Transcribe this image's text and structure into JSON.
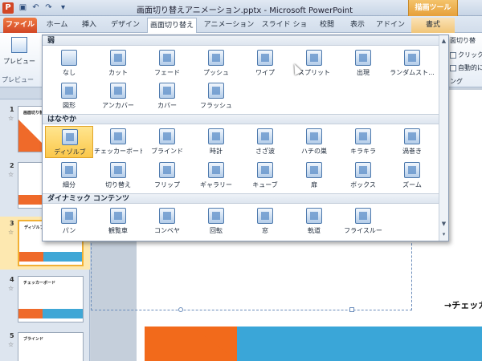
{
  "titlebar": {
    "app_icon": "P",
    "title": "画面切り替えアニメーション.pptx - Microsoft PowerPoint",
    "context_tab": "描画ツール",
    "qat_icons": [
      "save-icon",
      "undo-icon",
      "redo-icon",
      "customize-icon"
    ]
  },
  "tabs": [
    {
      "label": "ファイル",
      "kind": "file"
    },
    {
      "label": "ホーム"
    },
    {
      "label": "挿入"
    },
    {
      "label": "デザイン"
    },
    {
      "label": "画面切り替え",
      "kind": "active"
    },
    {
      "label": "アニメーション"
    },
    {
      "label": "スライド ショー"
    },
    {
      "label": "校閲"
    },
    {
      "label": "表示"
    },
    {
      "label": "アドイン"
    },
    {
      "label": "書式",
      "kind": "context"
    }
  ],
  "ribbon": {
    "preview_label": "プレビュー",
    "group_label": "プレビュー",
    "options": [
      "面切り替",
      "クリック時",
      "自動的に"
    ],
    "side_label": "ング"
  },
  "gallery": {
    "categories": [
      {
        "label": "弱",
        "items": [
          "なし",
          "カット",
          "フェード",
          "プッシュ",
          "ワイプ",
          "スプリット",
          "出現",
          "ランダムスト...",
          "図形",
          "アンカバー",
          "カバー",
          "フラッシュ"
        ]
      },
      {
        "label": "はなやか",
        "items": [
          "ディゾルブ",
          "チェッカーボード",
          "ブラインド",
          "時計",
          "さざ波",
          "ハチの巣",
          "キラキラ",
          "渦巻き",
          "細分",
          "切り替え",
          "フリップ",
          "ギャラリー",
          "キューブ",
          "扉",
          "ボックス",
          "ズーム"
        ]
      },
      {
        "label": "ダイナミック コンテンツ",
        "items": [
          "パン",
          "観覧車",
          "コンベヤ",
          "回転",
          "窓",
          "軌道",
          "フライスルー"
        ]
      }
    ],
    "selected": "ディゾルブ"
  },
  "slides": [
    {
      "num": "1",
      "title": "画面切り替えアニメーション",
      "star": "☆"
    },
    {
      "num": "2",
      "title": "",
      "star": "☆"
    },
    {
      "num": "3",
      "title": "ディゾルブ",
      "star": "☆"
    },
    {
      "num": "4",
      "title": "チェッカーボード",
      "star": "☆"
    },
    {
      "num": "5",
      "title": "ブラインド",
      "star": "☆"
    }
  ],
  "slide_text": "→チェッカ"
}
